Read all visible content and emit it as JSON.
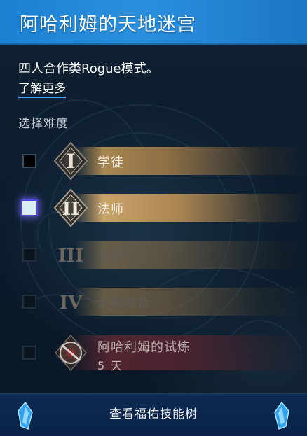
{
  "header": {
    "title": "阿哈利姆的天地迷宫"
  },
  "intro": {
    "description": "四人合作类Rogue模式。",
    "learn_more": "了解更多"
  },
  "difficulty": {
    "section_label": "选择难度",
    "options": [
      {
        "numeral": "I",
        "label": "学徒",
        "selected": false,
        "enabled": true
      },
      {
        "numeral": "II",
        "label": "法师",
        "selected": true,
        "enabled": true
      },
      {
        "numeral": "III",
        "label": "巫师",
        "selected": false,
        "enabled": false
      },
      {
        "numeral": "IV",
        "label": "大魔导师",
        "selected": false,
        "enabled": false
      },
      {
        "numeral": "",
        "label": "阿哈利姆的试炼",
        "sublabel": "5 天",
        "selected": false,
        "enabled": false
      }
    ]
  },
  "footer": {
    "button_label": "查看福佑技能树"
  },
  "colors": {
    "header_blue": "#2a90de",
    "gold_bar": "#a88650",
    "selection_glow": "#4a4ad6"
  }
}
